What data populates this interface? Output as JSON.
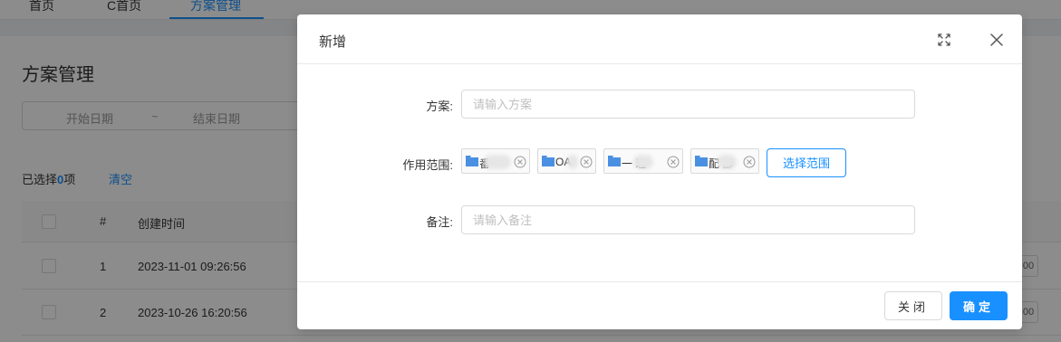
{
  "app": {
    "top_tabs": [
      {
        "label": "首页"
      },
      {
        "label": "C首页"
      },
      {
        "label": "方案管理"
      }
    ],
    "page_title": "方案管理",
    "date_range": {
      "start": "开始日期",
      "separator": "~",
      "end": "结束日期"
    },
    "selection": {
      "prefix": "已选择",
      "count": "0",
      "suffix": "项",
      "clear": "清空"
    },
    "table": {
      "headers": {
        "index": "#",
        "created_time": "创建时间"
      },
      "rows": [
        {
          "index": "1",
          "created_time": "2023-11-01 09:26:56",
          "action": "00"
        },
        {
          "index": "2",
          "created_time": "2023-10-26 16:20:56",
          "action": "00"
        }
      ]
    }
  },
  "modal": {
    "title": "新增",
    "fields": {
      "plan": {
        "label": "方案:",
        "placeholder": "请输入方案"
      },
      "scope": {
        "label": "作用范围:",
        "tags": [
          {
            "text": "番"
          },
          {
            "text": "OA"
          },
          {
            "text": "一 理"
          },
          {
            "text": "配 部"
          }
        ],
        "button": "选择范围"
      },
      "remark": {
        "label": "备注:",
        "placeholder": "请输入备注"
      }
    },
    "footer": {
      "close": "关闭",
      "confirm": "确定"
    }
  },
  "colors": {
    "accent": "#1890ff",
    "overlay": "rgba(0,0,0,0.45)",
    "folder_icon": "#4a90e2"
  }
}
